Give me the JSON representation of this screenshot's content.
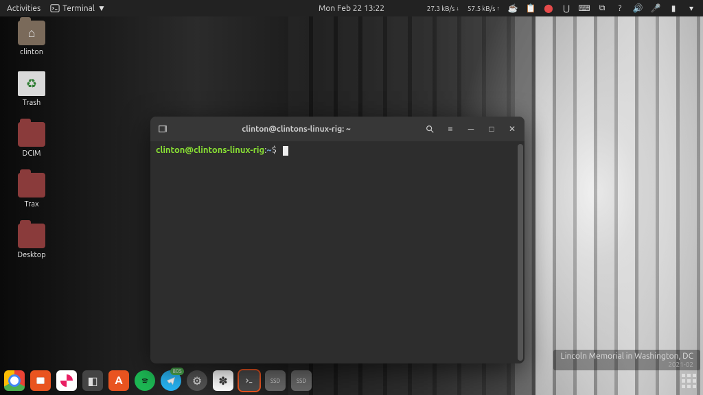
{
  "topbar": {
    "activities": "Activities",
    "app_name": "Terminal",
    "clock": "Mon Feb 22  13:22",
    "net_down": "27.3",
    "net_down_unit": "kB/s",
    "net_up": "57.5",
    "net_up_unit": "kB/s"
  },
  "desktop_icons": [
    {
      "label": "clinton",
      "kind": "home"
    },
    {
      "label": "Trash",
      "kind": "trash"
    },
    {
      "label": "DCIM",
      "kind": "folder"
    },
    {
      "label": "Trax",
      "kind": "folder"
    },
    {
      "label": "Desktop",
      "kind": "folder"
    }
  ],
  "terminal": {
    "title": "clinton@clintons-linux-rig: ~",
    "prompt_user": "clinton@clintons-linux-rig",
    "prompt_sep": ":",
    "prompt_path": "~",
    "prompt_symbol": "$"
  },
  "dock": {
    "telegram_badge": "805",
    "ssd_label": "SSD"
  },
  "wallpaper": {
    "caption": "Lincoln Memorial in Washington, DC",
    "date": "2021-02"
  }
}
